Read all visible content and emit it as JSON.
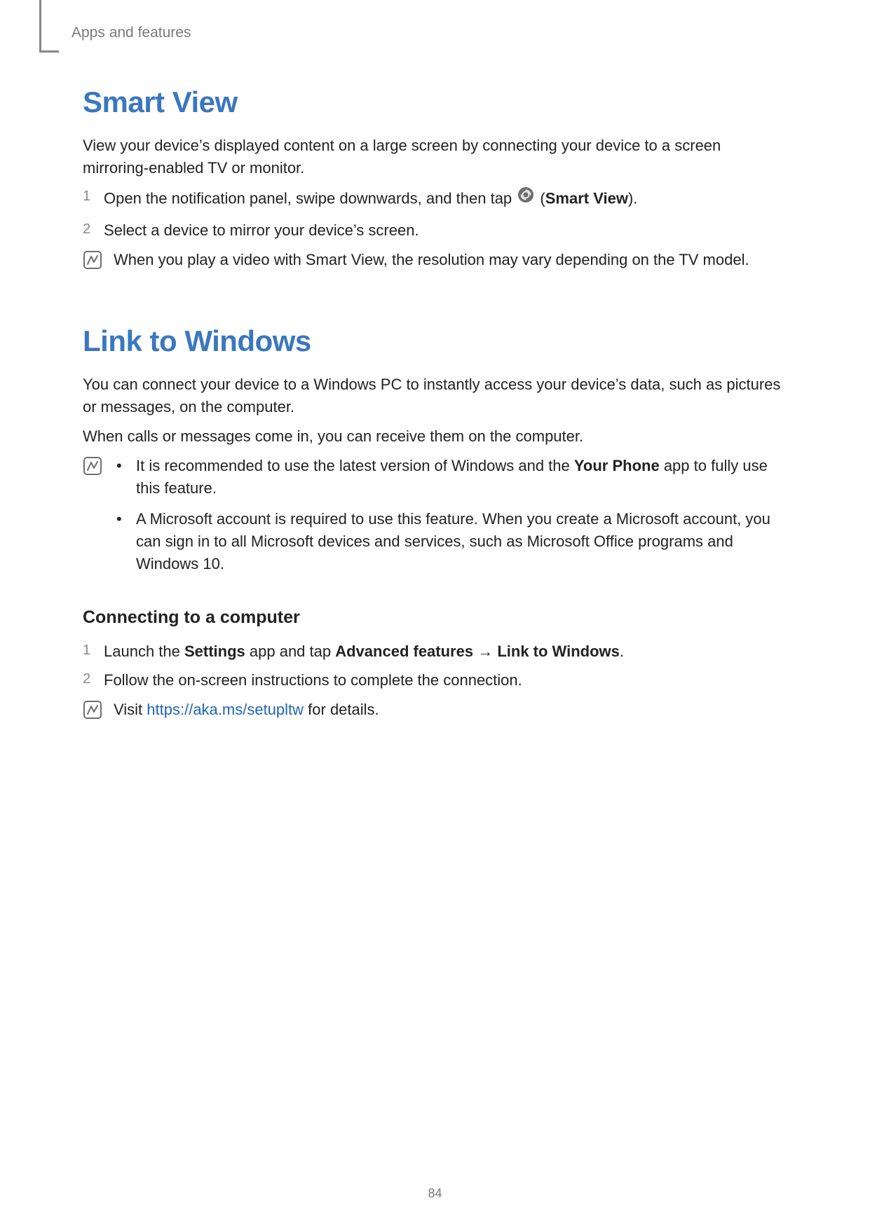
{
  "header": {
    "section_label": "Apps and features"
  },
  "smart_view": {
    "title": "Smart View",
    "intro": "View your device’s displayed content on a large screen by connecting your device to a screen mirroring-enabled TV or monitor.",
    "step1_pre": "Open the notification panel, swipe downwards, and then tap ",
    "step1_paren_open": " (",
    "step1_label": "Smart View",
    "step1_paren_close": ").",
    "step2": "Select a device to mirror your device’s screen.",
    "note": "When you play a video with Smart View, the resolution may vary depending on the TV model."
  },
  "link_windows": {
    "title": "Link to Windows",
    "intro1": "You can connect your device to a Windows PC to instantly access your device’s data, such as pictures or messages, on the computer.",
    "intro2": "When calls or messages come in, you can receive them on the computer.",
    "note_b1_pre": "It is recommended to use the latest version of Windows and the ",
    "note_b1_bold": "Your Phone",
    "note_b1_post": " app to fully use this feature.",
    "note_b2": "A Microsoft account is required to use this feature. When you create a Microsoft account, you can sign in to all Microsoft devices and services, such as Microsoft Office programs and Windows 10.",
    "subheading": "Connecting to a computer",
    "step1_pre": "Launch the ",
    "step1_b1": "Settings",
    "step1_mid1": " app and tap ",
    "step1_b2": "Advanced features",
    "step1_arrow": " → ",
    "step1_b3": "Link to Windows",
    "step1_post": ".",
    "step2": "Follow the on-screen instructions to complete the connection.",
    "note2_pre": "Visit ",
    "note2_link": "https://aka.ms/setupltw",
    "note2_post": " for details."
  },
  "page_number": "84"
}
